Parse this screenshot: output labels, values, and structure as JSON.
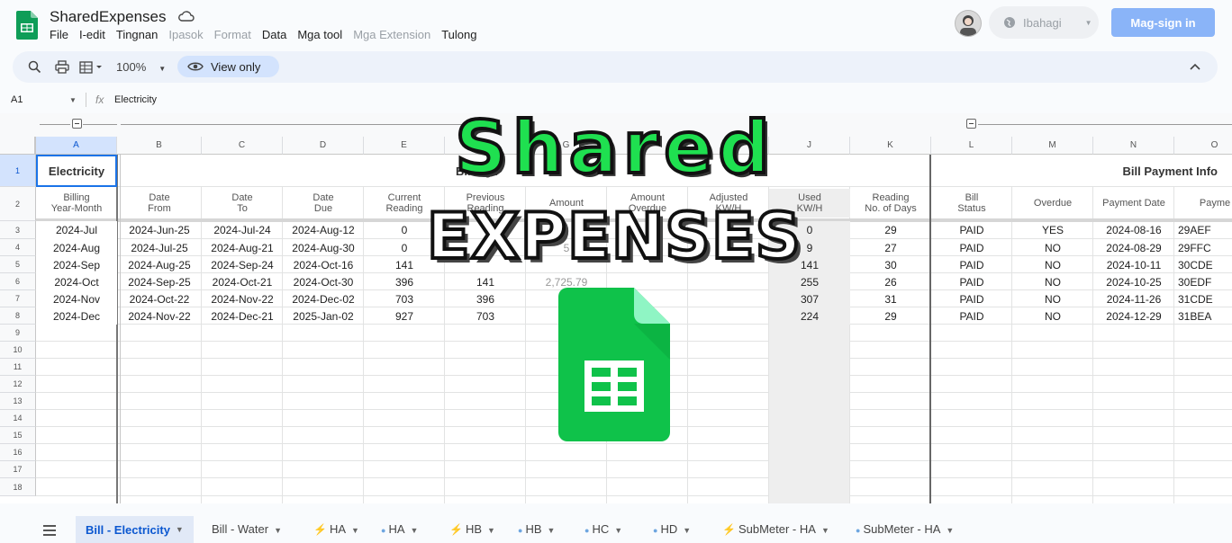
{
  "app": {
    "title": "SharedExpenses",
    "menu": [
      {
        "label": "File",
        "dim": false
      },
      {
        "label": "I-edit",
        "dim": false
      },
      {
        "label": "Tingnan",
        "dim": false
      },
      {
        "label": "Ipasok",
        "dim": true
      },
      {
        "label": "Format",
        "dim": true
      },
      {
        "label": "Data",
        "dim": false
      },
      {
        "label": "Mga tool",
        "dim": false
      },
      {
        "label": "Mga Extension",
        "dim": true
      },
      {
        "label": "Tulong",
        "dim": false
      }
    ],
    "share_label": "Ibahagi",
    "signin_label": "Mag-sign in",
    "accent": "#8ab4f8"
  },
  "toolbar": {
    "zoom": "100%",
    "view_only": "View only",
    "icons": [
      "search-icon",
      "print-icon",
      "format-icon",
      "chevron-up-icon"
    ]
  },
  "formula_bar": {
    "cell_ref": "A1",
    "fx": "fx",
    "content": "Electricity"
  },
  "grid": {
    "columns": [
      "A",
      "B",
      "C",
      "D",
      "E",
      "F",
      "G",
      "H",
      "I",
      "J",
      "K",
      "L",
      "M",
      "N",
      "O"
    ],
    "row_numbers": [
      "1",
      "2",
      "3",
      "4",
      "5",
      "6",
      "7",
      "8",
      "9",
      "10",
      "11",
      "12",
      "13",
      "14",
      "15",
      "16",
      "17",
      "18"
    ],
    "section_titles": {
      "electricity": "Electricity",
      "billing_partial": "Billing P",
      "payment": "Bill Payment Info"
    },
    "sub_headers": [
      "Billing\nYear-Month",
      "Date\nFrom",
      "Date\nTo",
      "Date\nDue",
      "Current\nReading",
      "Previous\nReading",
      "Amount",
      "Amount\nOverdue",
      "Adjusted\nKW/H",
      "Used\nKW/H",
      "Reading\nNo. of Days",
      "Bill\nStatus",
      "Overdue",
      "Payment Date",
      "Payme"
    ],
    "rows": [
      [
        "2024-Jul",
        "2024-Jun-25",
        "2024-Jul-24",
        "2024-Aug-12",
        "0",
        "",
        "",
        "",
        "",
        "0",
        "29",
        "PAID",
        "YES",
        "2024-08-16",
        "29AEF"
      ],
      [
        "2024-Aug",
        "2024-Jul-25",
        "2024-Aug-21",
        "2024-Aug-30",
        "0",
        "",
        "5",
        "",
        "",
        "9",
        "27",
        "PAID",
        "NO",
        "2024-08-29",
        "29FFC"
      ],
      [
        "2024-Sep",
        "2024-Aug-25",
        "2024-Sep-24",
        "2024-Oct-16",
        "141",
        "",
        "",
        "",
        "",
        "141",
        "30",
        "PAID",
        "NO",
        "2024-10-11",
        "30CDE"
      ],
      [
        "2024-Oct",
        "2024-Sep-25",
        "2024-Oct-21",
        "2024-Oct-30",
        "396",
        "141",
        "2,725.79",
        "",
        "",
        "255",
        "26",
        "PAID",
        "NO",
        "2024-10-25",
        "30EDF"
      ],
      [
        "2024-Nov",
        "2024-Oct-22",
        "2024-Nov-22",
        "2024-Dec-02",
        "703",
        "396",
        "",
        "",
        "",
        "307",
        "31",
        "PAID",
        "NO",
        "2024-11-26",
        "31CDE"
      ],
      [
        "2024-Dec",
        "2024-Nov-22",
        "2024-Dec-21",
        "2025-Jan-02",
        "927",
        "703",
        "",
        "",
        "",
        "224",
        "29",
        "PAID",
        "NO",
        "2024-12-29",
        "31BEA"
      ]
    ]
  },
  "tabs": [
    {
      "label": "Bill - Electricity",
      "icon": "",
      "active": true
    },
    {
      "label": "Bill - Water",
      "icon": "",
      "active": false
    },
    {
      "label": "HA",
      "icon": "lightning-icon",
      "active": false
    },
    {
      "label": "HA",
      "icon": "water-drop-icon",
      "active": false
    },
    {
      "label": "HB",
      "icon": "lightning-icon",
      "active": false
    },
    {
      "label": "HB",
      "icon": "water-drop-icon",
      "active": false
    },
    {
      "label": "HC",
      "icon": "water-drop-icon",
      "active": false
    },
    {
      "label": "HD",
      "icon": "water-drop-icon",
      "active": false
    },
    {
      "label": "SubMeter - HA",
      "icon": "lightning-icon",
      "active": false
    },
    {
      "label": "SubMeter - HA",
      "icon": "water-drop-icon",
      "active": false
    }
  ],
  "overlay": {
    "line1": "Shared",
    "line2": "EXPENSES",
    "line1_color": "#1fe050",
    "icon": "google-sheets-icon"
  }
}
